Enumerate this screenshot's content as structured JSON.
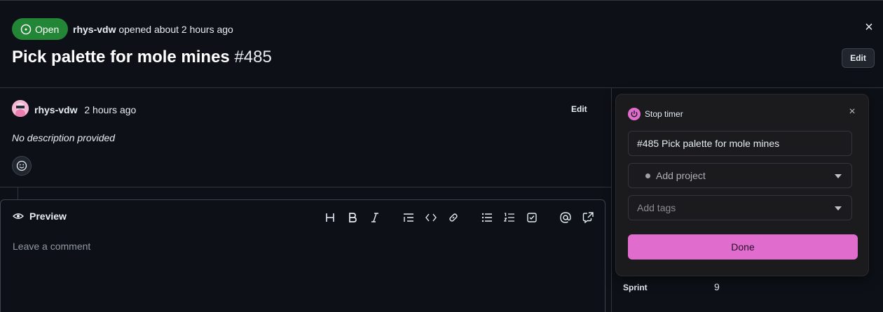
{
  "header": {
    "status_label": "Open",
    "author": "rhys-vdw",
    "opened_text": "opened about 2 hours ago",
    "title": "Pick palette for mole mines",
    "number": "#485",
    "edit_label": "Edit",
    "close_symbol": "×"
  },
  "comment": {
    "author": "rhys-vdw",
    "time": "2 hours ago",
    "edit_label": "Edit",
    "body": "No description provided"
  },
  "editor": {
    "tab_label": "Preview",
    "placeholder": "Leave a comment",
    "toolbar_icons": [
      "heading-icon",
      "bold-icon",
      "italic-icon",
      "quote-icon",
      "code-icon",
      "link-icon",
      "unordered-list-icon",
      "ordered-list-icon",
      "task-list-icon",
      "mention-icon",
      "reference-icon"
    ]
  },
  "sidebar": {
    "rows": [
      {
        "label": "Sprint",
        "value": "9"
      }
    ]
  },
  "timer_popup": {
    "title": "Stop timer",
    "close_symbol": "×",
    "task_text": "#485 Pick palette for mole mines",
    "project_placeholder": "Add project",
    "tags_placeholder": "Add tags",
    "done_label": "Done",
    "accent_color": "#e06dcd"
  },
  "colors": {
    "background": "#0d1117",
    "open_green": "#238636",
    "border": "#30363d"
  }
}
